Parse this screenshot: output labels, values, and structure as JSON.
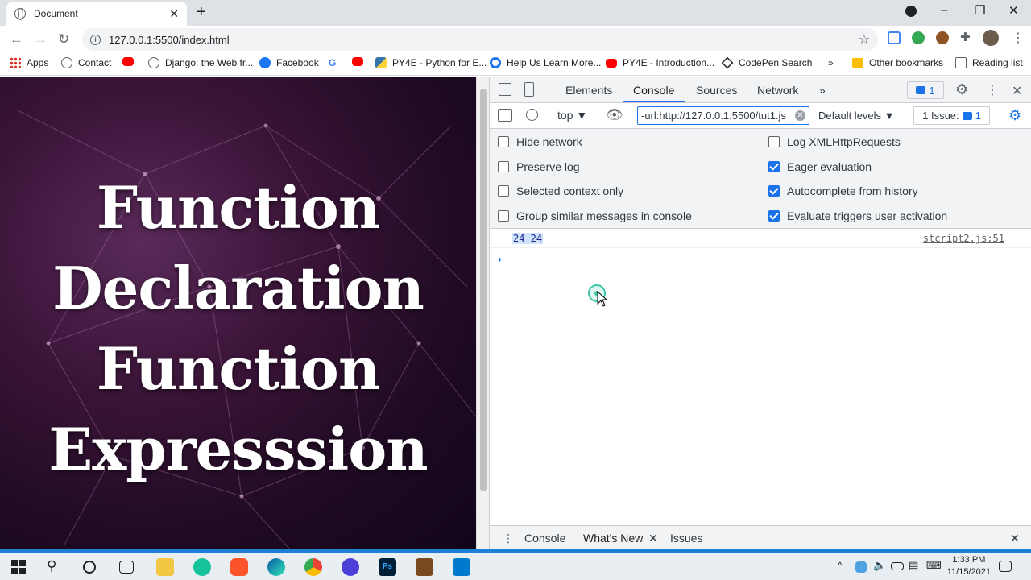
{
  "browser": {
    "tab_title": "Document",
    "tab_close": "✕",
    "new_tab": "+",
    "url": "127.0.0.1:5500/index.html",
    "bookmarks": [
      {
        "label": "Apps",
        "icon": "apps-grid-icon",
        "color": "#d93025"
      },
      {
        "label": "Contact",
        "icon": "globe-icon",
        "color": "#5f6368"
      },
      {
        "label": "",
        "icon": "youtube-icon",
        "color": "#ff0000"
      },
      {
        "label": "Django: the Web fr...",
        "icon": "globe-icon",
        "color": "#5f6368"
      },
      {
        "label": "Facebook",
        "icon": "facebook-icon",
        "color": "#1877f2"
      },
      {
        "label": "",
        "icon": "google-icon",
        "color": "#4285f4"
      },
      {
        "label": "",
        "icon": "youtube-icon",
        "color": "#ff0000"
      },
      {
        "label": "PY4E - Python for E...",
        "icon": "python-icon",
        "color": "#3776ab"
      },
      {
        "label": "Help Us Learn More...",
        "icon": "chrome-help-icon",
        "color": "#1a73e8"
      },
      {
        "label": "PY4E - Introduction...",
        "icon": "youtube-icon",
        "color": "#ff0000"
      },
      {
        "label": "CodePen Search",
        "icon": "codepen-icon",
        "color": "#202124"
      }
    ],
    "more_bookmarks": "»",
    "other_bookmarks": "Other bookmarks",
    "reading_list": "Reading list"
  },
  "page": {
    "headline_lines": [
      "Function",
      "Declaration",
      "Function",
      "Expresssion"
    ]
  },
  "devtools": {
    "tabs": [
      "Elements",
      "Console",
      "Sources",
      "Network"
    ],
    "active_tab": "Console",
    "more_tabs": "»",
    "issues_badge_count": "1",
    "close": "✕",
    "context": "top",
    "filter_value": "-url:http://127.0.0.1:5500/tut1.js",
    "levels": "Default levels ▼",
    "issues_label": "1 Issue:",
    "issues_count": "1",
    "settings_left": [
      {
        "label": "Hide network",
        "checked": false
      },
      {
        "label": "Preserve log",
        "checked": false
      },
      {
        "label": "Selected context only",
        "checked": false
      },
      {
        "label": "Group similar messages in console",
        "checked": false
      }
    ],
    "settings_right": [
      {
        "label": "Log XMLHttpRequests",
        "checked": false
      },
      {
        "label": "Eager evaluation",
        "checked": true
      },
      {
        "label": "Autocomplete from history",
        "checked": true
      },
      {
        "label": "Evaluate triggers user activation",
        "checked": true
      }
    ],
    "log_message": "24 24",
    "log_source": "stcript2.js:51",
    "prompt": "›",
    "drawer_tabs": [
      "Console",
      "What's New",
      "Issues"
    ],
    "drawer_close": "✕"
  },
  "taskbar": {
    "time": "1:33 PM",
    "date": "11/15/2021"
  },
  "colors": {
    "accent": "#1a73e8",
    "page_bg": "#2a0f2c",
    "headline": "#ffffff"
  }
}
